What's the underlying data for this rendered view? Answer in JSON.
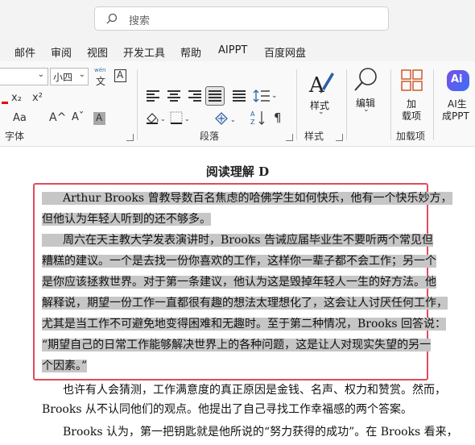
{
  "search": {
    "placeholder": "搜索"
  },
  "menu": [
    "邮件",
    "审阅",
    "视图",
    "开发工具",
    "帮助",
    "AIPPT",
    "百度网盘"
  ],
  "ribbon": {
    "font_size": "小四",
    "groups": {
      "font": "字体",
      "paragraph": "段落",
      "styles": "样式",
      "addins": "加载项"
    },
    "buttons": {
      "styles": "样式",
      "edit": "编辑",
      "addins_line1": "加",
      "addins_line2": "载项",
      "ai_line1": "AI生",
      "ai_line2": "成PPT"
    },
    "font_controls": {
      "subscript": "x₂",
      "superscript": "x²",
      "aa": "Aa",
      "grow": "A^",
      "shrink": "Aˇ",
      "highlight": "A",
      "wen": "wén",
      "wen_char": "文",
      "abox": "A"
    }
  },
  "document": {
    "heading": "阅读理解 D",
    "lines": [
      "Arthur Brooks 曾教导数百名焦虑的哈佛学生如何快乐，他有一个快乐妙方，",
      "但他认为年轻人听到的还不够多。",
      "周六在天主教大学发表演讲时，Brooks 告诫应届毕业生不要听两个常见但",
      "糟糕的建议。一个是去找一份你喜欢的工作，这样你一辈子都不会工作；另一个",
      "是你应该拯救世界。对于第一条建议，他认为这是毁掉年轻人一生的好方法。他",
      "解释说，期望一份工作一直都很有趣的想法太理想化了，这会让人讨厌任何工作，",
      "尤其是当工作不可避免地变得困难和无趣时。至于第二种情况，Brooks 回答说：",
      "“期望自己的日常工作能够解决世界上的各种问题，这是让人对现实失望的另一",
      "个因素。”",
      "也许有人会猜测，工作满意度的真正原因是金钱、名声、权力和赞赏。然而，",
      "Brooks 从不认同他们的观点。他提出了自己寻找工作幸福感的两个答案。",
      "Brooks 认为，第一把钥匙就是他所说的“努力获得的成功”。在 Brooks 看来，"
    ]
  }
}
